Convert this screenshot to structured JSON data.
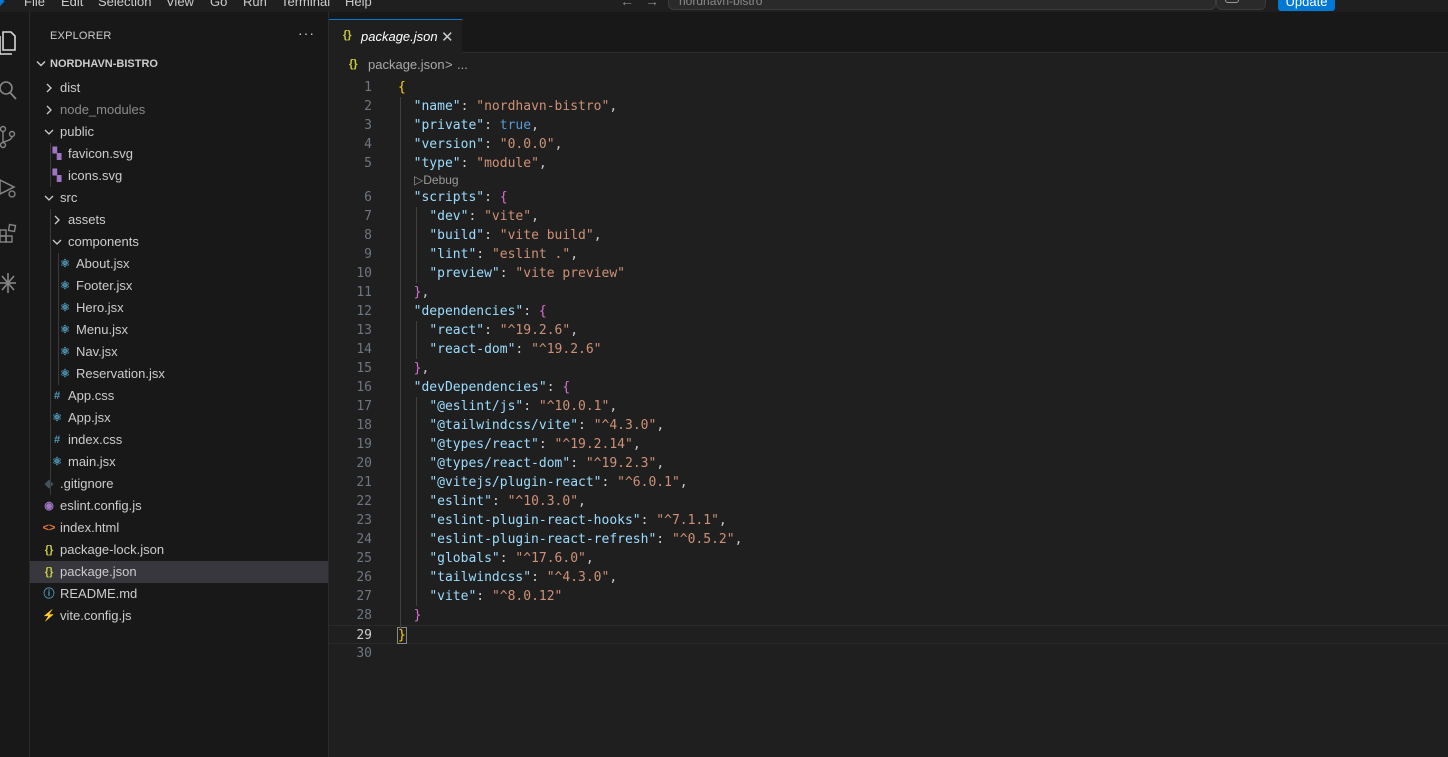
{
  "menu": [
    "File",
    "Edit",
    "Selection",
    "View",
    "Go",
    "Run",
    "Terminal",
    "Help"
  ],
  "command_center": {
    "text": "nordhavn-bistro"
  },
  "update_button": "Update",
  "explorer": {
    "title": "EXPLORER",
    "more": "···",
    "folder": "NORDHAVN-BISTRO",
    "items": [
      {
        "label": "dist",
        "type": "folder",
        "depth": 0,
        "expanded": false,
        "dim": false
      },
      {
        "label": "node_modules",
        "type": "folder",
        "depth": 0,
        "expanded": false,
        "dim": true
      },
      {
        "label": "public",
        "type": "folder",
        "depth": 0,
        "expanded": true,
        "dim": false
      },
      {
        "label": "favicon.svg",
        "type": "svg",
        "depth": 1
      },
      {
        "label": "icons.svg",
        "type": "svg",
        "depth": 1
      },
      {
        "label": "src",
        "type": "folder",
        "depth": 0,
        "expanded": true
      },
      {
        "label": "assets",
        "type": "folder",
        "depth": 1,
        "expanded": false
      },
      {
        "label": "components",
        "type": "folder",
        "depth": 1,
        "expanded": true
      },
      {
        "label": "About.jsx",
        "type": "react",
        "depth": 2
      },
      {
        "label": "Footer.jsx",
        "type": "react",
        "depth": 2
      },
      {
        "label": "Hero.jsx",
        "type": "react",
        "depth": 2
      },
      {
        "label": "Menu.jsx",
        "type": "react",
        "depth": 2
      },
      {
        "label": "Nav.jsx",
        "type": "react",
        "depth": 2
      },
      {
        "label": "Reservation.jsx",
        "type": "react",
        "depth": 2
      },
      {
        "label": "App.css",
        "type": "css",
        "depth": 1
      },
      {
        "label": "App.jsx",
        "type": "react",
        "depth": 1
      },
      {
        "label": "index.css",
        "type": "css",
        "depth": 1
      },
      {
        "label": "main.jsx",
        "type": "react",
        "depth": 1
      },
      {
        "label": ".gitignore",
        "type": "git",
        "depth": 0
      },
      {
        "label": "eslint.config.js",
        "type": "eslint",
        "depth": 0
      },
      {
        "label": "index.html",
        "type": "html",
        "depth": 0
      },
      {
        "label": "package-lock.json",
        "type": "json",
        "depth": 0
      },
      {
        "label": "package.json",
        "type": "json",
        "depth": 0,
        "selected": true
      },
      {
        "label": "README.md",
        "type": "info",
        "depth": 0
      },
      {
        "label": "vite.config.js",
        "type": "vite",
        "depth": 0
      }
    ]
  },
  "tab": {
    "icon": "{}",
    "label": "package.json",
    "close": "✕"
  },
  "breadcrumb": {
    "icon": "{}",
    "file": "package.json",
    "sep": ">",
    "more": "..."
  },
  "codelens": {
    "line_before": 6,
    "text": "Debug",
    "icon": "▷"
  },
  "current_line": 29,
  "code": [
    [
      {
        "t": "{",
        "c": "br1"
      }
    ],
    [
      {
        "t": "  "
      },
      {
        "t": "\"name\"",
        "c": "k"
      },
      {
        "t": ": "
      },
      {
        "t": "\"nordhavn-bistro\"",
        "c": "s"
      },
      {
        "t": ","
      }
    ],
    [
      {
        "t": "  "
      },
      {
        "t": "\"private\"",
        "c": "k"
      },
      {
        "t": ": "
      },
      {
        "t": "true",
        "c": "b"
      },
      {
        "t": ","
      }
    ],
    [
      {
        "t": "  "
      },
      {
        "t": "\"version\"",
        "c": "k"
      },
      {
        "t": ": "
      },
      {
        "t": "\"0.0.0\"",
        "c": "s"
      },
      {
        "t": ","
      }
    ],
    [
      {
        "t": "  "
      },
      {
        "t": "\"type\"",
        "c": "k"
      },
      {
        "t": ": "
      },
      {
        "t": "\"module\"",
        "c": "s"
      },
      {
        "t": ","
      }
    ],
    [
      {
        "t": "  "
      },
      {
        "t": "\"scripts\"",
        "c": "k"
      },
      {
        "t": ": "
      },
      {
        "t": "{",
        "c": "br2"
      }
    ],
    [
      {
        "t": "    "
      },
      {
        "t": "\"dev\"",
        "c": "k"
      },
      {
        "t": ": "
      },
      {
        "t": "\"vite\"",
        "c": "s"
      },
      {
        "t": ","
      }
    ],
    [
      {
        "t": "    "
      },
      {
        "t": "\"build\"",
        "c": "k"
      },
      {
        "t": ": "
      },
      {
        "t": "\"vite build\"",
        "c": "s"
      },
      {
        "t": ","
      }
    ],
    [
      {
        "t": "    "
      },
      {
        "t": "\"lint\"",
        "c": "k"
      },
      {
        "t": ": "
      },
      {
        "t": "\"eslint .\"",
        "c": "s"
      },
      {
        "t": ","
      }
    ],
    [
      {
        "t": "    "
      },
      {
        "t": "\"preview\"",
        "c": "k"
      },
      {
        "t": ": "
      },
      {
        "t": "\"vite preview\"",
        "c": "s"
      }
    ],
    [
      {
        "t": "  "
      },
      {
        "t": "}",
        "c": "br2"
      },
      {
        "t": ","
      }
    ],
    [
      {
        "t": "  "
      },
      {
        "t": "\"dependencies\"",
        "c": "k"
      },
      {
        "t": ": "
      },
      {
        "t": "{",
        "c": "br2"
      }
    ],
    [
      {
        "t": "    "
      },
      {
        "t": "\"react\"",
        "c": "k"
      },
      {
        "t": ": "
      },
      {
        "t": "\"^19.2.6\"",
        "c": "s"
      },
      {
        "t": ","
      }
    ],
    [
      {
        "t": "    "
      },
      {
        "t": "\"react-dom\"",
        "c": "k"
      },
      {
        "t": ": "
      },
      {
        "t": "\"^19.2.6\"",
        "c": "s"
      }
    ],
    [
      {
        "t": "  "
      },
      {
        "t": "}",
        "c": "br2"
      },
      {
        "t": ","
      }
    ],
    [
      {
        "t": "  "
      },
      {
        "t": "\"devDependencies\"",
        "c": "k"
      },
      {
        "t": ": "
      },
      {
        "t": "{",
        "c": "br2"
      }
    ],
    [
      {
        "t": "    "
      },
      {
        "t": "\"@eslint/js\"",
        "c": "k"
      },
      {
        "t": ": "
      },
      {
        "t": "\"^10.0.1\"",
        "c": "s"
      },
      {
        "t": ","
      }
    ],
    [
      {
        "t": "    "
      },
      {
        "t": "\"@tailwindcss/vite\"",
        "c": "k"
      },
      {
        "t": ": "
      },
      {
        "t": "\"^4.3.0\"",
        "c": "s"
      },
      {
        "t": ","
      }
    ],
    [
      {
        "t": "    "
      },
      {
        "t": "\"@types/react\"",
        "c": "k"
      },
      {
        "t": ": "
      },
      {
        "t": "\"^19.2.14\"",
        "c": "s"
      },
      {
        "t": ","
      }
    ],
    [
      {
        "t": "    "
      },
      {
        "t": "\"@types/react-dom\"",
        "c": "k"
      },
      {
        "t": ": "
      },
      {
        "t": "\"^19.2.3\"",
        "c": "s"
      },
      {
        "t": ","
      }
    ],
    [
      {
        "t": "    "
      },
      {
        "t": "\"@vitejs/plugin-react\"",
        "c": "k"
      },
      {
        "t": ": "
      },
      {
        "t": "\"^6.0.1\"",
        "c": "s"
      },
      {
        "t": ","
      }
    ],
    [
      {
        "t": "    "
      },
      {
        "t": "\"eslint\"",
        "c": "k"
      },
      {
        "t": ": "
      },
      {
        "t": "\"^10.3.0\"",
        "c": "s"
      },
      {
        "t": ","
      }
    ],
    [
      {
        "t": "    "
      },
      {
        "t": "\"eslint-plugin-react-hooks\"",
        "c": "k"
      },
      {
        "t": ": "
      },
      {
        "t": "\"^7.1.1\"",
        "c": "s"
      },
      {
        "t": ","
      }
    ],
    [
      {
        "t": "    "
      },
      {
        "t": "\"eslint-plugin-react-refresh\"",
        "c": "k"
      },
      {
        "t": ": "
      },
      {
        "t": "\"^0.5.2\"",
        "c": "s"
      },
      {
        "t": ","
      }
    ],
    [
      {
        "t": "    "
      },
      {
        "t": "\"globals\"",
        "c": "k"
      },
      {
        "t": ": "
      },
      {
        "t": "\"^17.6.0\"",
        "c": "s"
      },
      {
        "t": ","
      }
    ],
    [
      {
        "t": "    "
      },
      {
        "t": "\"tailwindcss\"",
        "c": "k"
      },
      {
        "t": ": "
      },
      {
        "t": "\"^4.3.0\"",
        "c": "s"
      },
      {
        "t": ","
      }
    ],
    [
      {
        "t": "    "
      },
      {
        "t": "\"vite\"",
        "c": "k"
      },
      {
        "t": ": "
      },
      {
        "t": "\"^8.0.12\"",
        "c": "s"
      }
    ],
    [
      {
        "t": "  "
      },
      {
        "t": "}",
        "c": "br2"
      }
    ],
    [
      {
        "t": "}",
        "c": "br1-hl"
      }
    ],
    []
  ],
  "colors": {
    "accent": "#0078d4",
    "json_icon": "#cbcb41",
    "react_icon": "#519aba",
    "svg_icon": "#a074c4",
    "css_icon": "#519aba",
    "html_icon": "#e37933",
    "git_icon": "#41535b",
    "vite_icon": "#ffc517",
    "eslint_icon": "#a074c4",
    "info_icon": "#519aba"
  }
}
